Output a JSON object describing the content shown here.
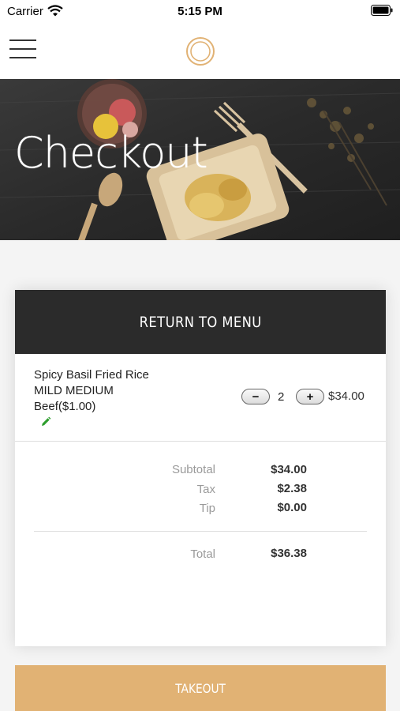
{
  "status_bar": {
    "carrier": "Carrier",
    "time": "5:15 PM"
  },
  "header": {
    "logo_icon": "ring-logo-icon",
    "menu_icon": "hamburger-menu-icon",
    "accent_color": "#e1b274"
  },
  "hero": {
    "title": "Checkout"
  },
  "card": {
    "return_label": "RETURN TO MENU",
    "item": {
      "name": "Spicy Basil Fried Rice",
      "option": "MILD MEDIUM",
      "addon": "Beef($1.00)",
      "quantity": "2",
      "price": "$34.00",
      "minus_label": "−",
      "plus_label": "+",
      "edit_icon": "pencil-icon"
    },
    "totals": {
      "subtotal_label": "Subtotal",
      "subtotal_value": "$34.00",
      "tax_label": "Tax",
      "tax_value": "$2.38",
      "tip_label": "Tip",
      "tip_value": "$0.00",
      "total_label": "Total",
      "total_value": "$36.38"
    }
  },
  "takeout_label": "TAKEOUT"
}
